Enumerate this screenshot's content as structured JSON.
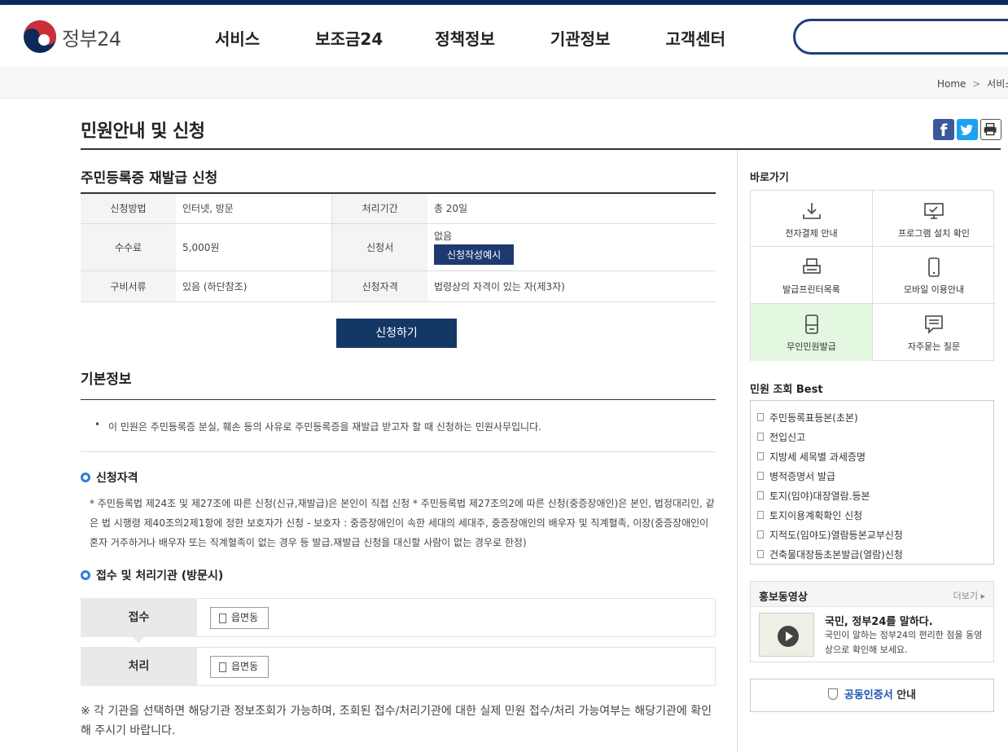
{
  "header": {
    "logo_text": "정부24",
    "nav": [
      "서비스",
      "보조금24",
      "정책정보",
      "기관정보",
      "고객센터"
    ]
  },
  "breadcrumb": {
    "home": "Home",
    "sep": ">",
    "current": "서비스"
  },
  "page": {
    "title": "민원안내 및 신청"
  },
  "service": {
    "title": "주민등록증 재발급 신청",
    "rows": [
      {
        "k1": "신청방법",
        "v1": "인터넷, 방문",
        "k2": "처리기간",
        "v2": "총 20일"
      },
      {
        "k1": "수수료",
        "v1": "5,000원",
        "k2": "신청서",
        "v2": "없음"
      },
      {
        "k1": "구비서류",
        "v1": "있음 (하단참조)",
        "k2": "신청자격",
        "v2": "법령상의 자격이 있는 자(제3자)"
      }
    ],
    "sample_button": "신청작성예시",
    "apply_button": "신청하기"
  },
  "basic": {
    "title": "기본정보",
    "bullet": "이 민원은 주민등록증 분실, 훼손 등의 사유로 주민등록증을 재발급 받고자 할 때 신청하는 민원사무입니다."
  },
  "qualification": {
    "title": "신청자격",
    "text": "* 주민등록법 제24조 및 제27조에 따른 신청(신규,재발급)은 본인이 직접 신청 * 주민등록법 제27조의2에 따른 신청(중증장애인)은 본인, 법정대리인, 같은 법 시행령 제40조의2제1항에 정한 보호자가 신청 - 보호자 : 중증장애인이 속한 세대의 세대주, 중증장애인의 배우자 및 직계혈족, 이장(중증장애인이 혼자 거주하거나 배우자 또는 직계혈족이 없는 경우 등 발급.재발급 신청을 대신할 사람이 없는 경우로 한정)"
  },
  "processing": {
    "title": "접수 및 처리기관 (방문시)",
    "reception_label": "접수",
    "process_label": "처리",
    "office_button": "읍면동",
    "note": "※ 각 기관을 선택하면 해당기관 정보조회가 가능하며, 조회된 접수/처리기관에 대한 실제 민원 접수/처리 가능여부는 해당기관에 확인해 주시기 바랍니다."
  },
  "sidebar": {
    "quick_title": "바로가기",
    "quick": [
      "전자결제 안내",
      "프로그램 설치 확인",
      "발급프린터목록",
      "모바일 이용안내",
      "무인민원발급",
      "자주묻는 질문"
    ],
    "best_title": "민원 조회 Best",
    "best": [
      "주민등록표등본(초본)",
      "전입신고",
      "지방세 세목별 과세증명",
      "병적증명서 발급",
      "토지(임야)대장열람.등본",
      "토지이용계획확인 신청",
      "지적도(임야도)열람등본교부신청",
      "건축물대장등초본발급(열람)신청"
    ],
    "promo_title": "홍보동영상",
    "promo_more": "더보기 ▸",
    "promo_video_title": "국민, 정부24를 말하다.",
    "promo_video_desc": "국민이 말하는 정부24의 편리한 점을 동영상으로 확인해 보세요.",
    "cert_blue": "공동인증서",
    "cert_rest": " 안내"
  },
  "colors": {
    "navy": "#0b2a5b",
    "button": "#143866",
    "accent": "#2f7fd8",
    "highlight": "#e4f7e0"
  }
}
